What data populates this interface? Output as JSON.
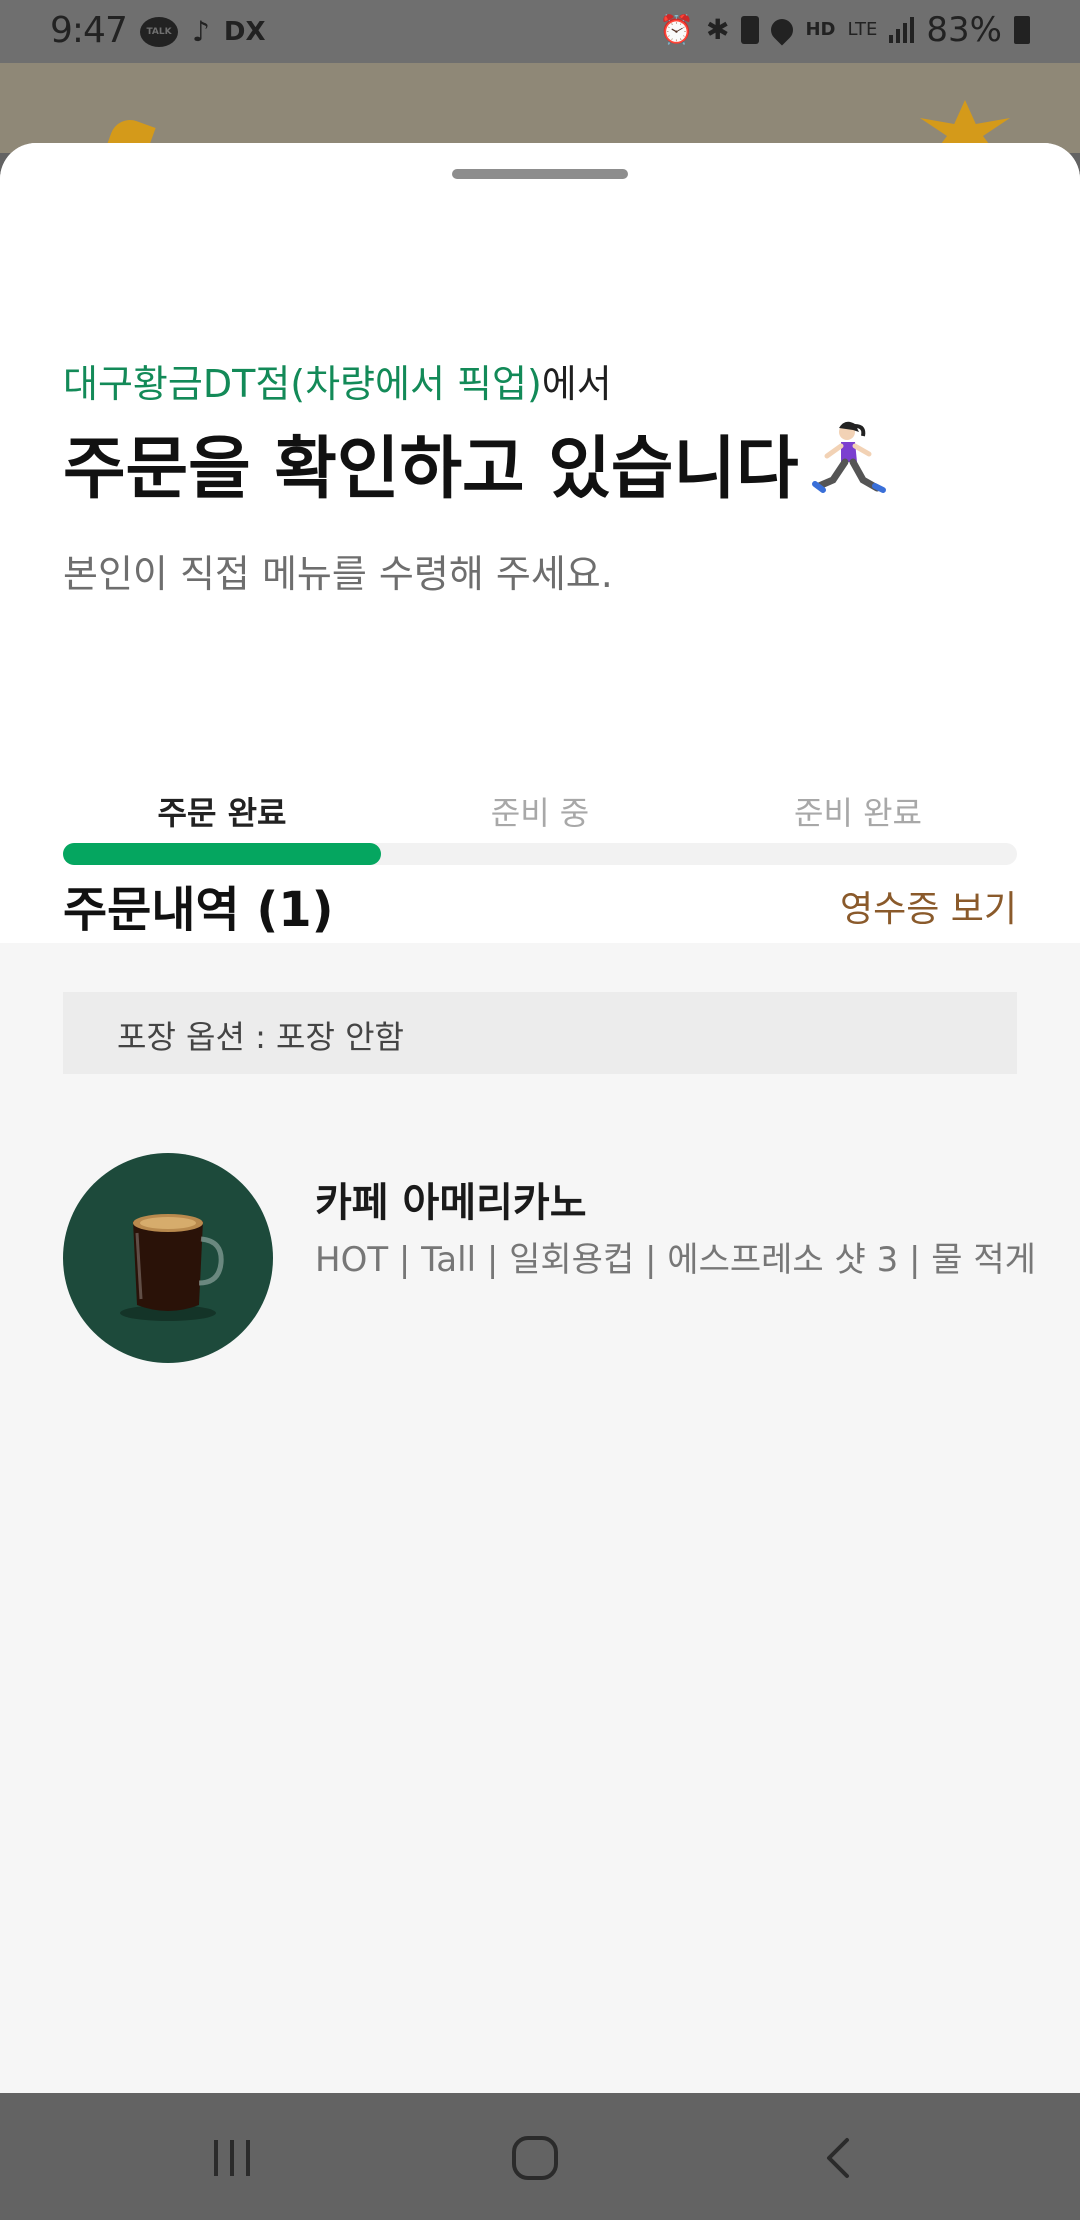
{
  "status_bar": {
    "time": "9:47",
    "battery": "83%",
    "left_icons": [
      "kakaotalk-icon",
      "tiktok-icon",
      "dx-icon"
    ],
    "right_icons": [
      "alarm-icon",
      "bluetooth-icon",
      "battery-saver-icon",
      "location-icon",
      "hd-voice-icon",
      "lte-icon",
      "signal-icon",
      "battery-icon"
    ],
    "talk_label": "TALK",
    "dx_label": "DX",
    "hd_label": "HD",
    "lte_label": "LTE"
  },
  "sheet": {
    "store_name": "대구황금DT점(차량에서 픽업)",
    "store_suffix": "에서",
    "headline": "주문을 확인하고 있습니다",
    "subtext": "본인이 직접 메뉴를 수령해 주세요.",
    "steps": [
      "주문 완료",
      "준비 중",
      "준비 완료"
    ],
    "active_step": 0,
    "progress_fraction": 0.333,
    "accent_color": "#05a660"
  },
  "order": {
    "title": "주문내역 (1)",
    "receipt_link": "영수증 보기",
    "pack_option": "포장 옵션 : 포장 안함",
    "items": [
      {
        "name": "카페 아메리카노",
        "options": "HOT | Tall | 일회용컵 | 에스프레소 샷 3 | 물 적게",
        "image": "americano-glass-cup"
      }
    ]
  },
  "nav_bar": {
    "buttons": [
      "recents-icon",
      "home-icon",
      "back-icon"
    ]
  }
}
